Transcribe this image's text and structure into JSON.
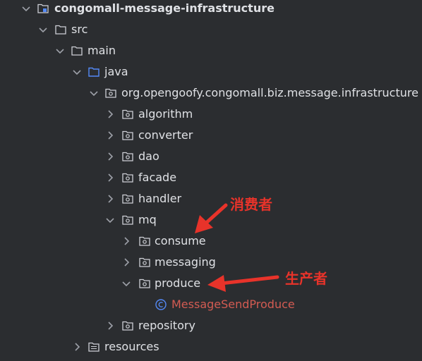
{
  "tree": {
    "root": "congomall-message-infrastructure",
    "src": "src",
    "main": "main",
    "java": "java",
    "package": "org.opengoofy.congomall.biz.message.infrastructure",
    "algorithm": "algorithm",
    "converter": "converter",
    "dao": "dao",
    "facade": "facade",
    "handler": "handler",
    "mq": "mq",
    "consume": "consume",
    "messaging": "messaging",
    "produce": "produce",
    "class_file": "MessageSendProduce",
    "repository": "repository",
    "resources": "resources"
  },
  "annotations": {
    "consumer": "消费者",
    "producer": "生产者"
  },
  "colors": {
    "background": "#2b2d30",
    "text": "#dfe1e5",
    "class_text": "#d35b52",
    "java_folder": "#548af7",
    "annotation": "#e8332a"
  }
}
